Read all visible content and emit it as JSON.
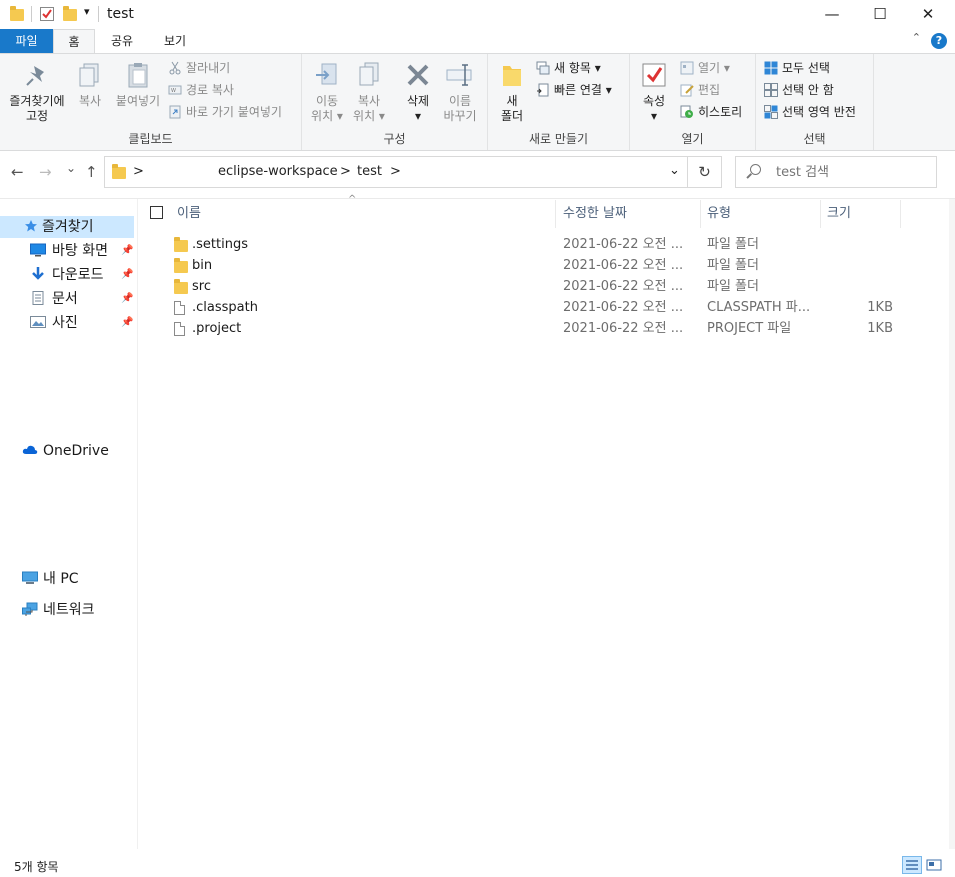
{
  "window": {
    "title": "test",
    "qa_dropdown": "▾",
    "min": "—",
    "max": "☐",
    "close": "✕"
  },
  "tabs": [
    "파일",
    "홈",
    "공유",
    "보기"
  ],
  "help": "?",
  "collapse": "⌃",
  "ribbon": {
    "clipboard": {
      "label": "클립보드",
      "pin_line1": "즐겨찾기에",
      "pin_line2": "고정",
      "copy": "복사",
      "paste": "붙여넣기",
      "cut": "잘라내기",
      "copy_path": "경로 복사",
      "paste_shortcut": "바로 가기 붙여넣기"
    },
    "organize": {
      "label": "구성",
      "move_line1": "이동",
      "move_line2": "위치 ▾",
      "copyto_line1": "복사",
      "copyto_line2": "위치 ▾",
      "delete_line1": "삭제",
      "delete_line2": "▾",
      "rename_line1": "이름",
      "rename_line2": "바꾸기"
    },
    "new": {
      "label": "새로 만들기",
      "folder_line1": "새",
      "folder_line2": "폴더",
      "new_item": "새 항목 ▾",
      "easy_access": "빠른 연결 ▾"
    },
    "open": {
      "label": "열기",
      "props_line1": "속성",
      "props_line2": "▾",
      "open": "열기 ▾",
      "edit": "편집",
      "history": "히스토리"
    },
    "select": {
      "label": "선택",
      "select_all": "모두 선택",
      "select_none": "선택 안 함",
      "invert": "선택 영역 반전"
    }
  },
  "nav": {
    "back": "←",
    "forward": "→",
    "recent": "⌄",
    "up": "↑",
    "breadcrumb": [
      ">",
      "eclipse-workspace",
      ">",
      "test",
      ">"
    ],
    "dropdown": "⌄",
    "refresh": "↻",
    "search_placeholder": "test 검색"
  },
  "navpane": {
    "quick_access": "즐겨찾기",
    "items": [
      {
        "label": "바탕 화면",
        "icon": "desktop-icon"
      },
      {
        "label": "다운로드",
        "icon": "download-icon"
      },
      {
        "label": "문서",
        "icon": "documents-icon"
      },
      {
        "label": "사진",
        "icon": "pictures-icon"
      }
    ],
    "pin": "📌",
    "onedrive": "OneDrive",
    "this_pc": "내 PC",
    "network": "네트워크"
  },
  "columns": {
    "name": "이름",
    "date": "수정한 날짜",
    "type": "유형",
    "size": "크기",
    "sort_caret": "^"
  },
  "files": [
    {
      "name": ".settings",
      "date": "2021-06-22 오전 ...",
      "type": "파일 폴더",
      "size": "",
      "kind": "folder"
    },
    {
      "name": "bin",
      "date": "2021-06-22 오전 ...",
      "type": "파일 폴더",
      "size": "",
      "kind": "folder"
    },
    {
      "name": "src",
      "date": "2021-06-22 오전 ...",
      "type": "파일 폴더",
      "size": "",
      "kind": "folder"
    },
    {
      "name": ".classpath",
      "date": "2021-06-22 오전 ...",
      "type": "CLASSPATH 파...",
      "size": "1KB",
      "kind": "file"
    },
    {
      "name": ".project",
      "date": "2021-06-22 오전 ...",
      "type": "PROJECT 파일",
      "size": "1KB",
      "kind": "file"
    }
  ],
  "status": {
    "count": "5개 항목"
  },
  "colors": {
    "accent": "#1979ca",
    "folder": "#f5c950",
    "selection": "#cce8ff",
    "ribbon_bg": "#f5f6f7"
  }
}
